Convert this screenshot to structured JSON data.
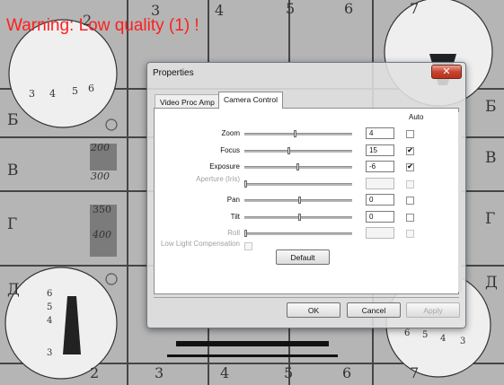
{
  "overlay": {
    "warning": "Warning: Low quality (1) !"
  },
  "dialog": {
    "title": "Properties",
    "tabs": [
      "Video Proc Amp",
      "Camera Control"
    ],
    "auto_header": "Auto",
    "controls": [
      {
        "label": "Zoom",
        "value": "4",
        "auto": "",
        "enabled": true,
        "level": 0.46
      },
      {
        "label": "Focus",
        "value": "15",
        "auto": "✔",
        "enabled": true,
        "level": 0.4
      },
      {
        "label": "Exposure",
        "value": "-6",
        "auto": "✔",
        "enabled": true,
        "level": 0.48
      },
      {
        "label": "Aperture (Iris)",
        "value": "",
        "auto": "",
        "enabled": false,
        "level": 0.0
      },
      {
        "label": "Pan",
        "value": "0",
        "auto": "",
        "enabled": true,
        "level": 0.5
      },
      {
        "label": "Tilt",
        "value": "0",
        "auto": "",
        "enabled": true,
        "level": 0.5
      },
      {
        "label": "Roll",
        "value": "",
        "auto": "",
        "enabled": false,
        "level": 0.0
      }
    ],
    "low_light_label": "Low Light Compensation",
    "default_label": "Default",
    "ok_label": "OK",
    "cancel_label": "Cancel",
    "apply_label": "Apply",
    "close_icon": "close-x-icon"
  },
  "background": {
    "chart_text": [
      "2",
      "3",
      "4",
      "5",
      "6",
      "7",
      "3",
      "4",
      "5",
      "6",
      "Б",
      "Б",
      "В",
      "В",
      "200",
      "300",
      "350",
      "400",
      "Г",
      "Г",
      "Д",
      "Д",
      "6",
      "5",
      "4",
      "3",
      "2",
      "3",
      "4",
      "5",
      "6",
      "7",
      "6",
      "5",
      "4",
      "3"
    ]
  },
  "colors": {
    "warning": "#ff1f1f",
    "close_button": "#c7442e"
  }
}
